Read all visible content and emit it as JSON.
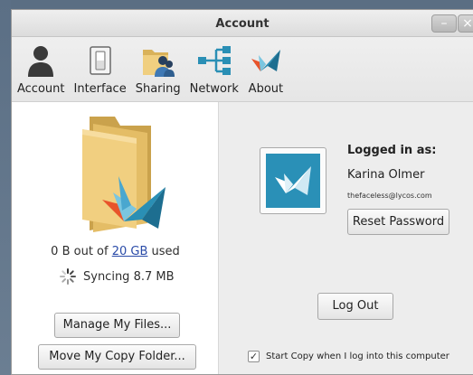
{
  "window": {
    "title": "Account",
    "minimize_glyph": "–",
    "close_glyph": "×"
  },
  "toolbar": {
    "items": [
      {
        "label": "Account",
        "icon": "person-icon"
      },
      {
        "label": "Interface",
        "icon": "switch-icon"
      },
      {
        "label": "Sharing",
        "icon": "shared-folder-icon"
      },
      {
        "label": "Network",
        "icon": "network-icon"
      },
      {
        "label": "About",
        "icon": "copy-logo-icon"
      }
    ]
  },
  "storage": {
    "used_prefix": "0 B out of",
    "quota_link": "20 GB",
    "used_suffix": "used",
    "sync_status": "Syncing 8.7 MB",
    "manage_button": "Manage My Files...",
    "move_button": "Move My Copy Folder..."
  },
  "account": {
    "logged_in_label": "Logged in as:",
    "user_name": "Karina Olmer",
    "email": "thefaceless@lycos.com",
    "reset_button": "Reset Password",
    "logout_button": "Log Out",
    "startup_check_label": "Start Copy when I log into this computer",
    "startup_checked": true
  },
  "colors": {
    "brand": "#2a90b7",
    "link": "#2a4ba8",
    "desktop": "#5a6e83"
  }
}
